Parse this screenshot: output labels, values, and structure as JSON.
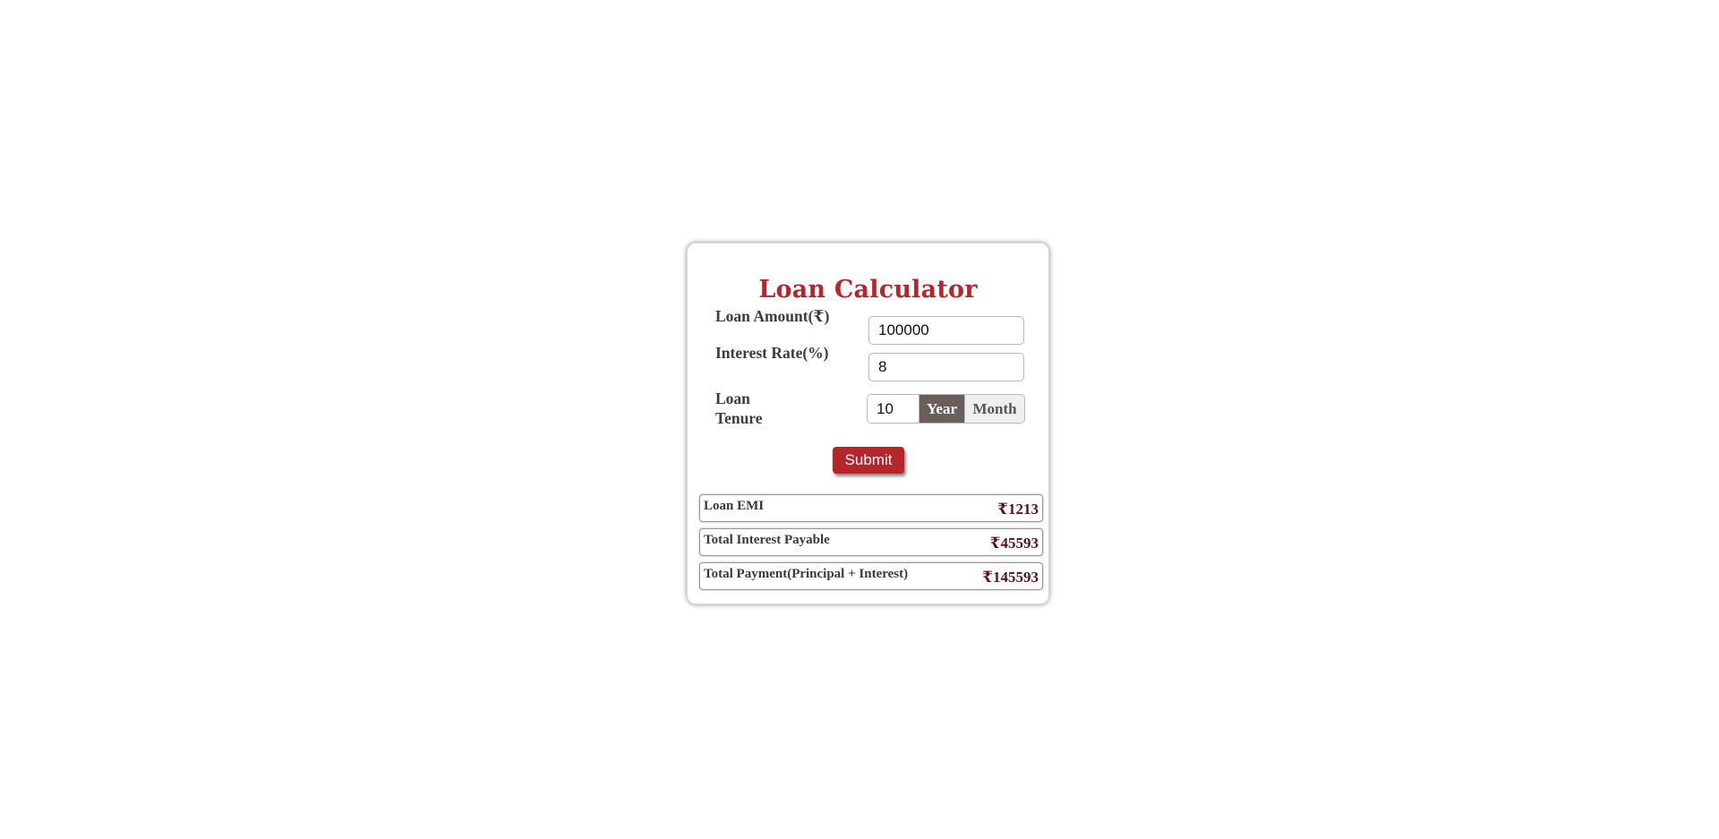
{
  "calculator": {
    "title": "Loan Calculator",
    "amount_label": "Loan Amount(₹)",
    "amount_value": "100000",
    "rate_label": "Interest Rate(%)",
    "rate_value": "8",
    "tenure_label": "Loan Tenure",
    "tenure_value": "10",
    "tenure_units": {
      "year": "Year",
      "month": "Month",
      "selected": "Year"
    },
    "submit_label": "Submit"
  },
  "results": [
    {
      "label": "Loan EMI",
      "value": "₹1213"
    },
    {
      "label": "Total Interest Payable",
      "value": "₹45593"
    },
    {
      "label": "Total Payment(Principal + Interest)",
      "value": "₹145593"
    }
  ],
  "colors": {
    "accent": "#b5262b",
    "selected_unit": "#6b5d59",
    "result_value": "#5a1024"
  }
}
